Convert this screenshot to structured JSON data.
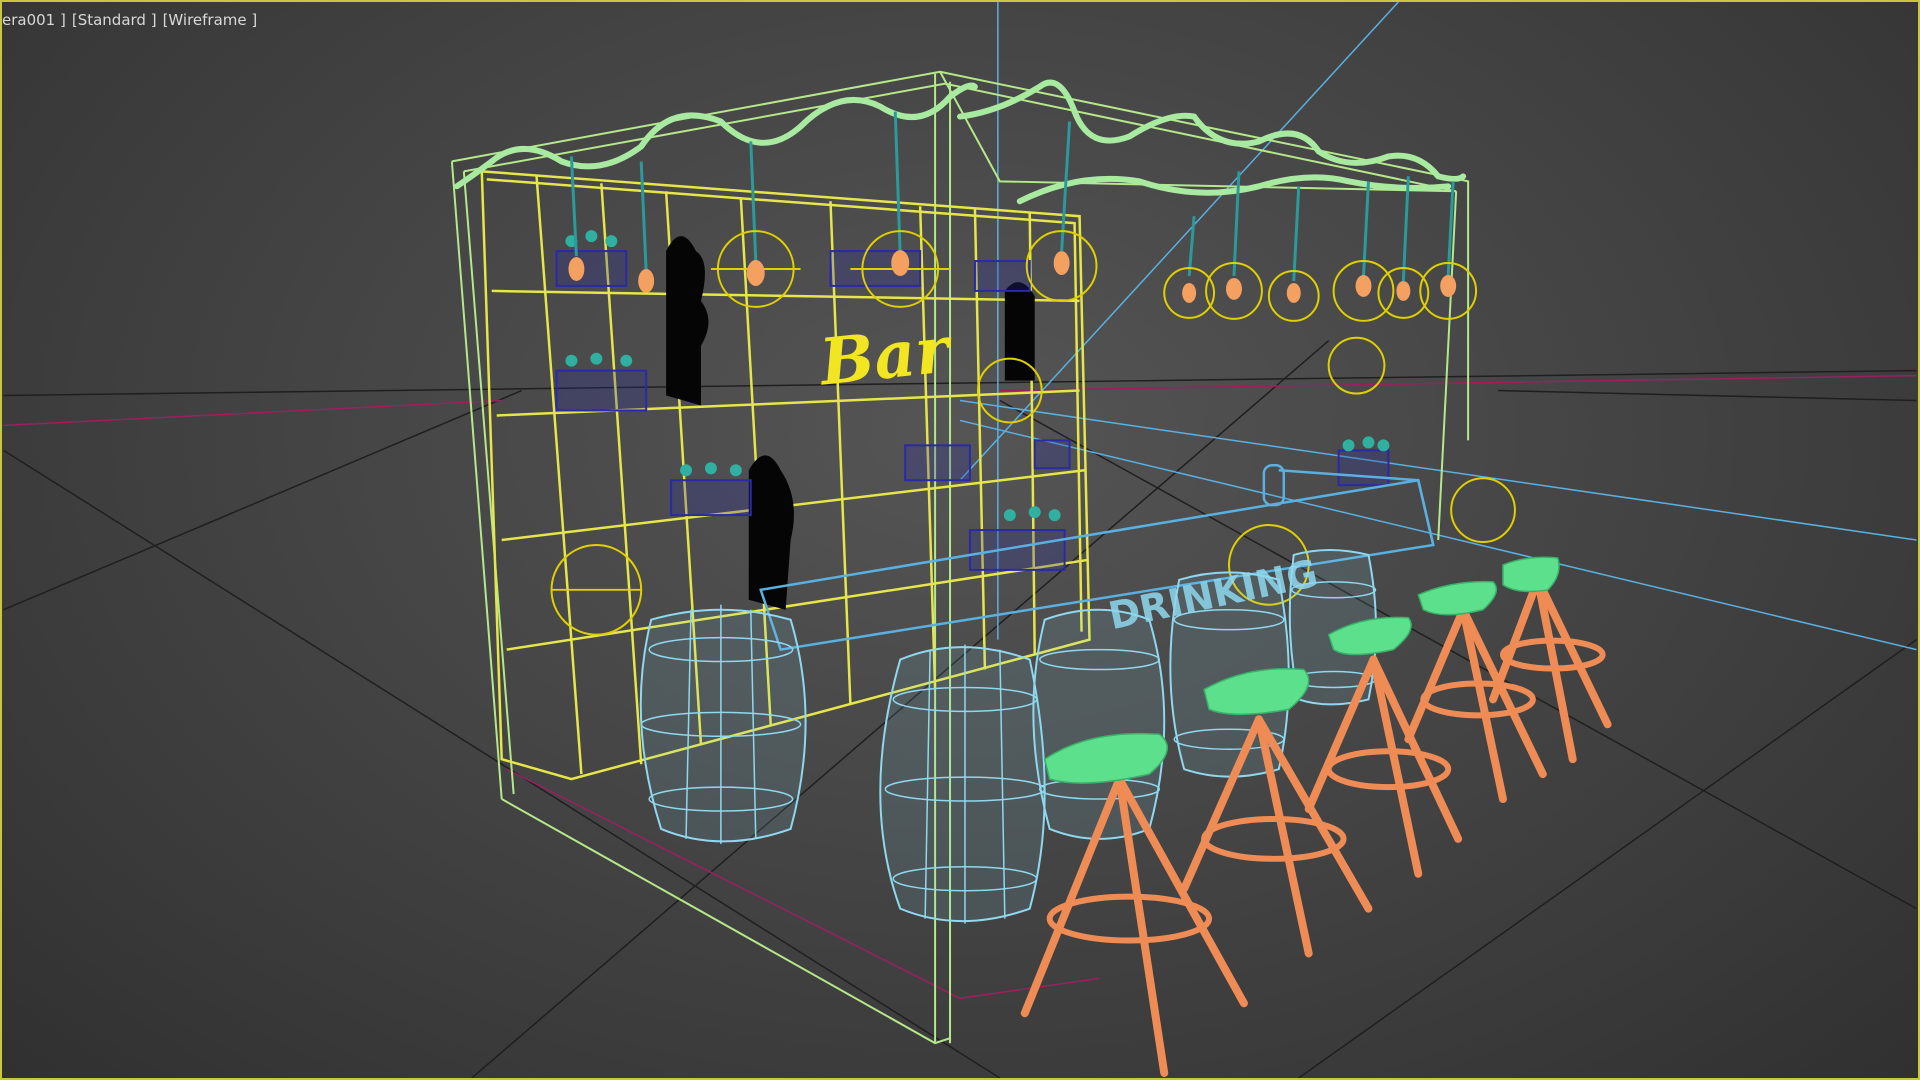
{
  "viewport": {
    "label": {
      "camera": "era001 ]",
      "shading_mode": "[Standard ]",
      "display_mode": "[Wireframe ]"
    },
    "border_color": "#c8c83a",
    "background_color": "#474747"
  },
  "scene": {
    "sign_text": "Bar",
    "counter_text": "DRINKING",
    "colors": {
      "shelf_wireframe": "#e6e64a",
      "frame_wireframe": "#b5e88a",
      "garland": "#a8eaa0",
      "bulb": "#f4a060",
      "bulb_cord": "#2b9a9a",
      "bottles": "#2a2aa8",
      "bottle_caps": "#2fb0a0",
      "barrels": "#8fd8ef",
      "stool_seats": "#5ce08c",
      "stool_legs": "#ef8c55",
      "light_gizmo": "#e0d000",
      "camera_line": "#5ab0e0",
      "floor_guide": "#9c2060",
      "grid": "#1a1a1a"
    }
  }
}
